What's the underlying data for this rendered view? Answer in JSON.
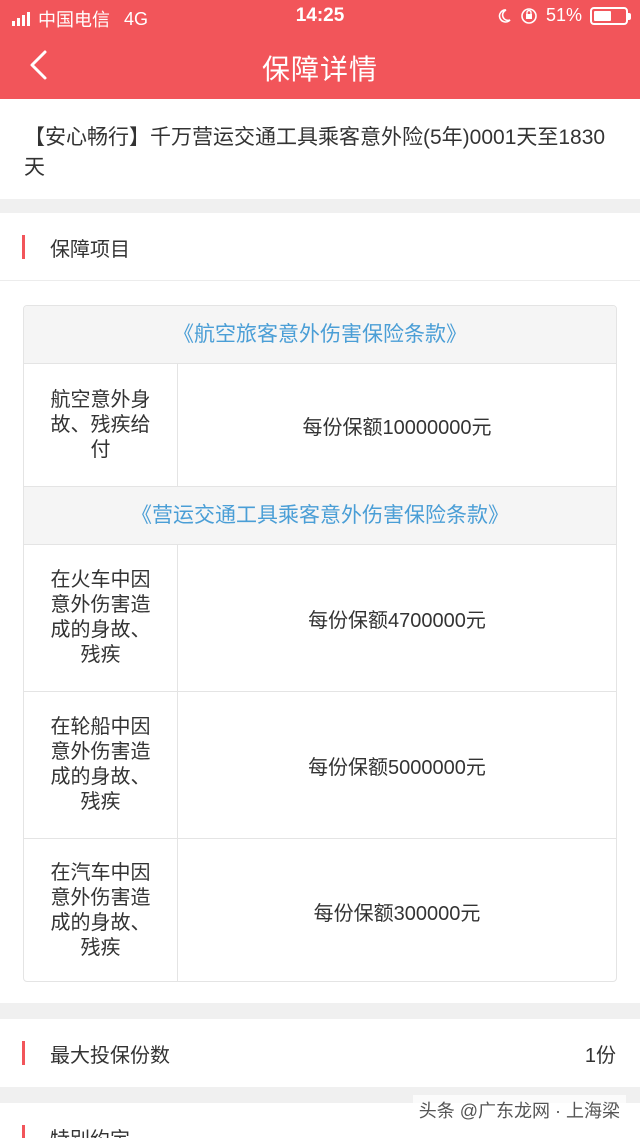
{
  "status_bar": {
    "carrier": "中国电信",
    "network": "4G",
    "time": "14:25",
    "battery": "51%"
  },
  "nav": {
    "title": "保障详情"
  },
  "product": {
    "title": "【安心畅行】千万营运交通工具乘客意外险(5年)0001天至1830天"
  },
  "coverage": {
    "section_label": "保障项目",
    "groups": [
      {
        "clause": "《航空旅客意外伤害保险条款》",
        "items": [
          {
            "name": "航空意外身故、残疾给付",
            "amount": "每份保额10000000元"
          }
        ]
      },
      {
        "clause": "《营运交通工具乘客意外伤害保险条款》",
        "items": [
          {
            "name": "在火车中因意外伤害造成的身故、残疾",
            "amount": "每份保额4700000元"
          },
          {
            "name": "在轮船中因意外伤害造成的身故、残疾",
            "amount": "每份保额5000000元"
          },
          {
            "name": "在汽车中因意外伤害造成的身故、残疾",
            "amount": "每份保额300000元"
          }
        ]
      }
    ]
  },
  "max_copies": {
    "label": "最大投保份数",
    "value": "1份"
  },
  "special": {
    "label": "特别约定"
  },
  "watermark": "头条 @广东龙网 · 上海梁",
  "colors": {
    "header": "#f2555a",
    "accent_bar": "#f2555a",
    "clause_text": "#4a9ed6"
  }
}
